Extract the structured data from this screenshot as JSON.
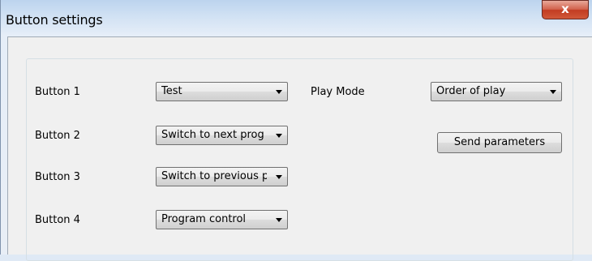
{
  "window": {
    "title": "Button settings",
    "close_glyph": "x"
  },
  "form": {
    "rows": [
      {
        "label": "Button 1",
        "value": "Test"
      },
      {
        "label": "Button 2",
        "value": "Switch to next prog"
      },
      {
        "label": "Button 3",
        "value": "Switch to previous p"
      },
      {
        "label": "Button 4",
        "value": "Program control"
      }
    ],
    "play_mode": {
      "label": "Play Mode",
      "value": "Order of play"
    },
    "send_button_label": "Send parameters"
  },
  "icons": {
    "dropdown_arrow": "chevron-down-icon",
    "close": "close-icon"
  },
  "colors": {
    "close_button": "#c8442a",
    "title_bar": "#cfe0f3",
    "client_background": "#f0f0f0"
  }
}
